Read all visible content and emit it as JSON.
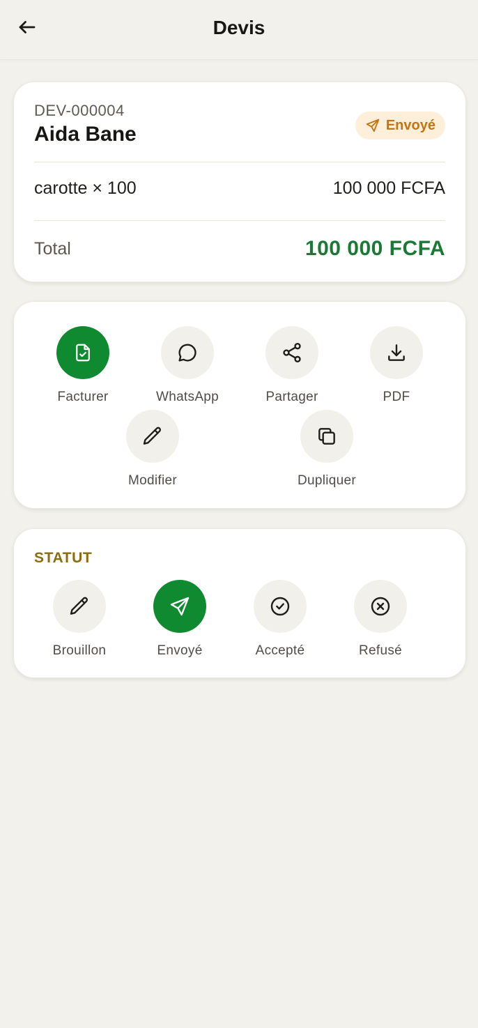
{
  "header": {
    "title": "Devis"
  },
  "quote": {
    "reference": "DEV-000004",
    "client": "Aida Bane",
    "status_badge": "Envoyé",
    "line_items": [
      {
        "description": "carotte × 100",
        "amount": "100 000 FCFA"
      }
    ],
    "total_label": "Total",
    "total_value": "100 000 FCFA"
  },
  "actions": [
    {
      "label": "Facturer",
      "icon": "invoice-check-icon",
      "active": true
    },
    {
      "label": "WhatsApp",
      "icon": "chat-bubble-icon",
      "active": false
    },
    {
      "label": "Partager",
      "icon": "share-icon",
      "active": false
    },
    {
      "label": "PDF",
      "icon": "download-icon",
      "active": false
    },
    {
      "label": "Modifier",
      "icon": "pencil-icon",
      "active": false
    },
    {
      "label": "Dupliquer",
      "icon": "copy-icon",
      "active": false
    }
  ],
  "status_section": {
    "title": "STATUT",
    "options": [
      {
        "label": "Brouillon",
        "icon": "pencil-icon",
        "selected": false
      },
      {
        "label": "Envoyé",
        "icon": "send-icon",
        "selected": true
      },
      {
        "label": "Accepté",
        "icon": "check-circle-icon",
        "selected": false
      },
      {
        "label": "Refusé",
        "icon": "x-circle-icon",
        "selected": false
      }
    ]
  },
  "colors": {
    "background": "#f2f1eb",
    "accent_green": "#108a31",
    "total_green": "#1a7a33",
    "badge_bg": "#fdefd9",
    "badge_text": "#c7730f",
    "status_title": "#8a6d0c"
  }
}
